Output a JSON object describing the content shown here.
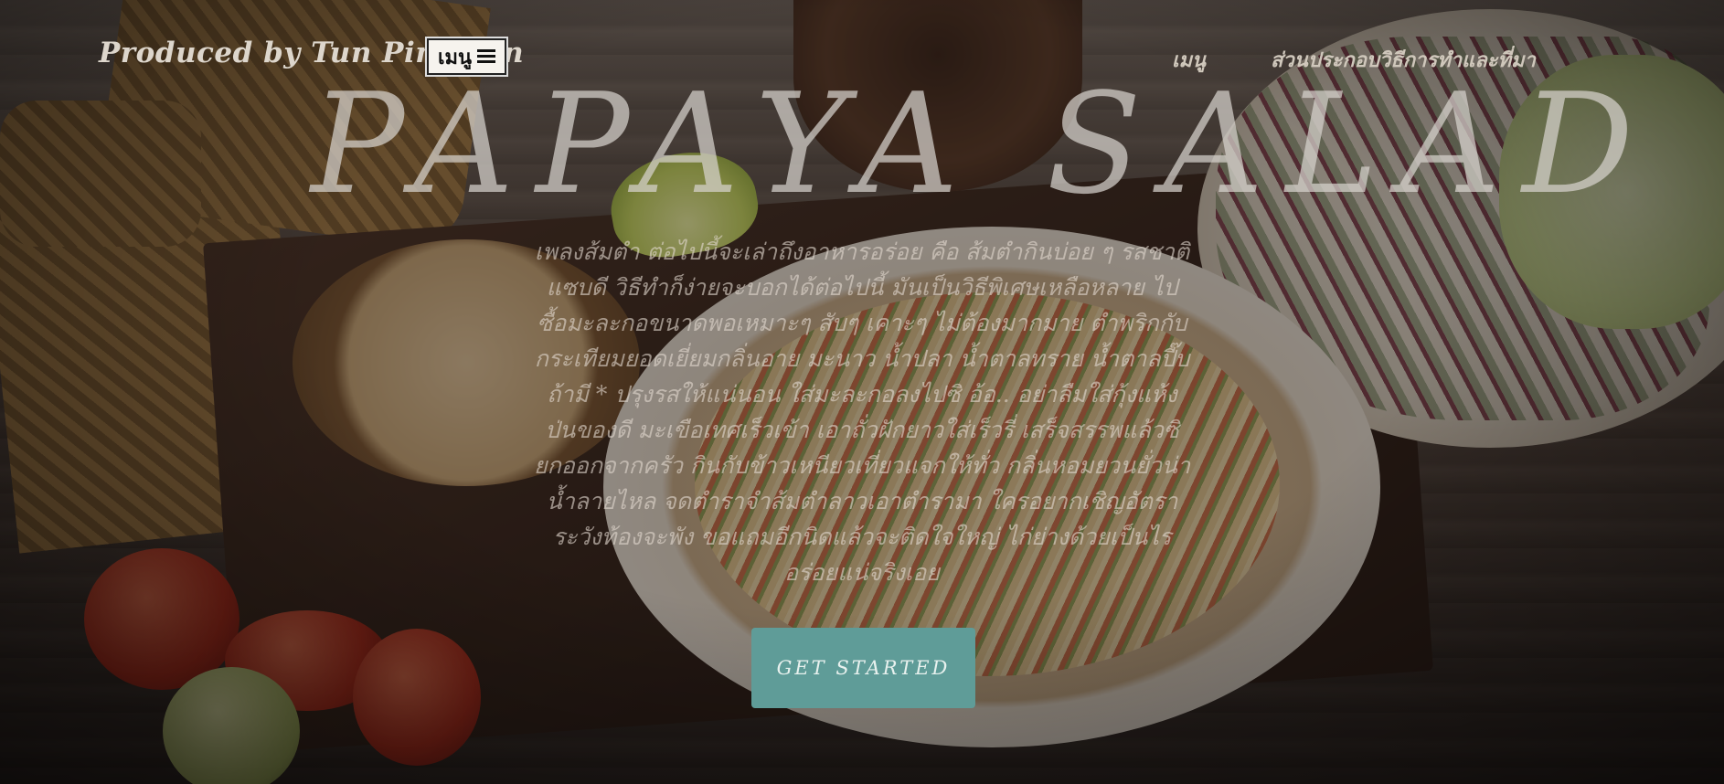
{
  "nav": {
    "brand": "Produced by Tun Pin Eran",
    "menu_label": "เมนู",
    "links": [
      "เมนู",
      "ส่วนประกอบวิธีการทำและที่มา"
    ]
  },
  "hero": {
    "title": "PAPAYA SALAD",
    "text": "เพลงส้มตำ ต่อไปนี้จะเล่าถึงอาหารอร่อย คือ ส้มตำกินบ่อย ๆ รสชาติแซบดี วิธีทำก็ง่ายจะบอกได้ต่อไปนี้ มันเป็นวิธีพิเศษเหลือหลาย ไปซื้อมะละกอขนาดพอเหมาะๆ สับๆ เคาะๆ ไม่ต้องมากมาย ตำพริกกับกระเทียมยอดเยี่ยมกลิ่นอาย มะนาว น้ำปลา น้ำตาลทราย น้ำตาลปี๊บถ้ามี * ปรุงรสให้แน่นอน ใส่มะละกอลงไปซิ อ้อ.. อย่าลืมใส่กุ้งแห้งป่นของดี มะเขือเทศเร็วเข้า เอาถั่วฝักยาวใส่เร็วรี่ เสร็จสรรพแล้วซิยกออกจากครัว กินกับข้าวเหนียวเที่ยวแจกให้ทั่ว กลิ่นหอมยวนยั่วน่าน้ำลายไหล จดตำราจำส้มตำลาวเอาตำรามา ใครอยากเชิญอัตราระวังท้องจะพัง ขอแถมอีกนิดแล้วจะติดใจใหญ่ ไก่ย่างด้วยเป็นไรอร่อยแน่จริงเอย",
    "cta_label": "GET STARTED"
  }
}
